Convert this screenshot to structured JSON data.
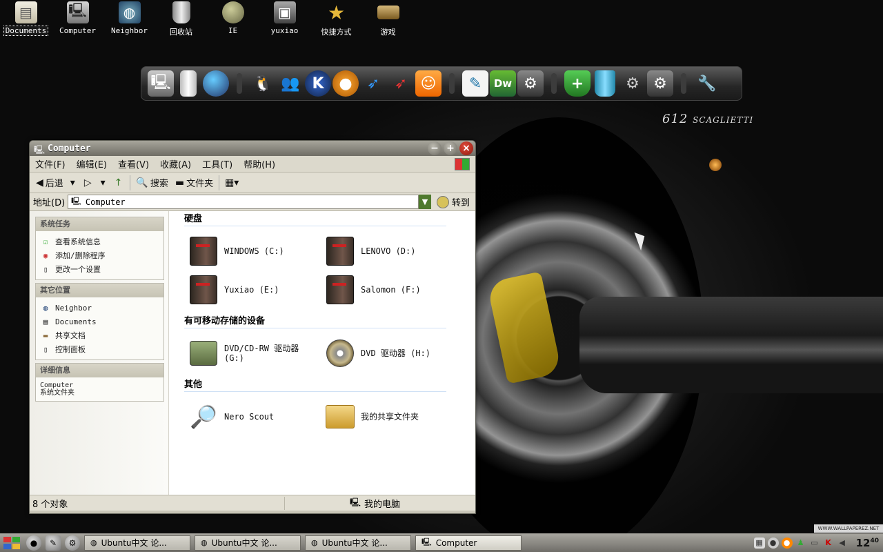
{
  "desktop": {
    "icons": [
      {
        "label": "Documents",
        "icon": "documents-icon"
      },
      {
        "label": "Computer",
        "icon": "computer-icon"
      },
      {
        "label": "Neighbor",
        "icon": "network-icon"
      },
      {
        "label": "回收站",
        "icon": "recycle-bin-icon"
      },
      {
        "label": "IE",
        "icon": "globe-icon"
      },
      {
        "label": "yuxiao",
        "icon": "user-folder-icon"
      },
      {
        "label": "快捷方式",
        "icon": "star-icon"
      },
      {
        "label": "游戏",
        "icon": "game-box-icon"
      }
    ],
    "logo_text": "612",
    "logo_sub": "SCAGLIETTI",
    "watermark": "WWW.WALLPAPEREZ.NET"
  },
  "dock": {
    "icons": [
      "computer",
      "usb",
      "globe",
      "qq-penguin",
      "msn",
      "kugou",
      "media-player",
      "bird-1",
      "bird-2",
      "pps",
      "feather",
      "dw-label",
      "settings",
      "shield-plus",
      "recycle-bin",
      "gears",
      "control-panel",
      "wrench"
    ],
    "dw_label": "Dw"
  },
  "window": {
    "title": "Computer",
    "menu": [
      "文件(F)",
      "编辑(E)",
      "查看(V)",
      "收藏(A)",
      "工具(T)",
      "帮助(H)"
    ],
    "toolbar": {
      "back": "后退",
      "search": "搜索",
      "folders": "文件夹"
    },
    "address": {
      "label": "地址(D)",
      "value": "Computer",
      "go": "转到"
    },
    "sidebar": {
      "system_tasks": {
        "title": "系统任务",
        "items": [
          "查看系统信息",
          "添加/删除程序",
          "更改一个设置"
        ]
      },
      "other_places": {
        "title": "其它位置",
        "items": [
          "Neighbor",
          "Documents",
          "共享文档",
          "控制面板"
        ]
      },
      "details": {
        "title": "详细信息",
        "line1": "Computer",
        "line2": "系统文件夹"
      }
    },
    "groups": {
      "hard_disks": {
        "title": "硬盘",
        "items": [
          "WINDOWS (C:)",
          "LENOVO (D:)",
          "Yuxiao (E:)",
          "Salomon (F:)"
        ]
      },
      "removable": {
        "title": "有可移动存储的设备",
        "items": [
          "DVD/CD-RW 驱动器 (G:)",
          "DVD 驱动器 (H:)"
        ]
      },
      "other": {
        "title": "其他",
        "items": [
          "Nero Scout",
          "我的共享文件夹"
        ]
      }
    },
    "status": {
      "count": "8 个对象",
      "location": "我的电脑"
    }
  },
  "taskbar": {
    "tasks": [
      "Ubuntu中文 论...",
      "Ubuntu中文 论...",
      "Ubuntu中文 论...",
      "Computer"
    ],
    "clock": "12",
    "clock_min": "40"
  }
}
